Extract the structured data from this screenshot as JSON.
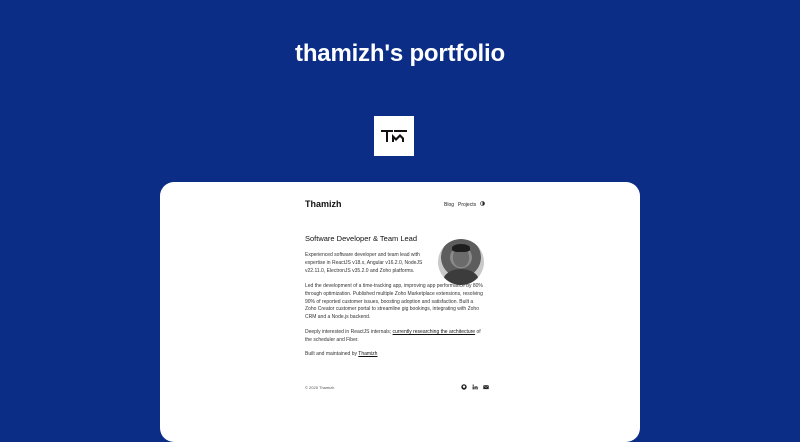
{
  "page": {
    "title": "thamizh's portfolio"
  },
  "logo": {
    "icon": "tm-monogram-logo"
  },
  "card": {
    "site_name": "Thamizh",
    "nav": {
      "blog": "Blog",
      "projects": "Projects",
      "theme_toggle_icon": "theme-toggle-icon"
    },
    "heading": "Software Developer & Team Lead",
    "paragraphs": {
      "p1": "Experienced software developer and team lead with expertise in ReactJS v18.x, Angular v16.2.0, NodeJS v22.11.0, ElectronJS v35.2.0 and Zoho platforms.",
      "p2": "Led the development of a time-tracking app, improving app performance by 80% through optimization. Published multiple Zoho Marketplace extensions, resolving 90% of reported customer issues, boosting adoption and satisfaction. Built a Zoho Creator customer portal to streamline gig bookings, integrating with Zoho CRM and a Node.js backend.",
      "p3_prefix": "Deeply interested in ReactJS internals; ",
      "p3_link": "currently researching the architecture",
      "p3_suffix": " of the scheduler and Fiber.",
      "p4_prefix": "Built and maintained by ",
      "p4_link": "Thamizh"
    },
    "footer": {
      "copyright": "© 2025 Thamizh",
      "icons": [
        "github-icon",
        "linkedin-icon",
        "mail-icon"
      ]
    }
  },
  "colors": {
    "background": "#0b2d86",
    "card": "#ffffff",
    "title_text": "#ffffff"
  }
}
